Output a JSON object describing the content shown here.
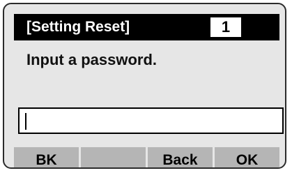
{
  "title_bar": {
    "title": "[Setting Reset]",
    "page_number": "1"
  },
  "prompt": "Input a password.",
  "password_input": {
    "value": ""
  },
  "softkeys": [
    {
      "label": "BK"
    },
    {
      "label": ""
    },
    {
      "label": "Back"
    },
    {
      "label": "OK"
    }
  ]
}
